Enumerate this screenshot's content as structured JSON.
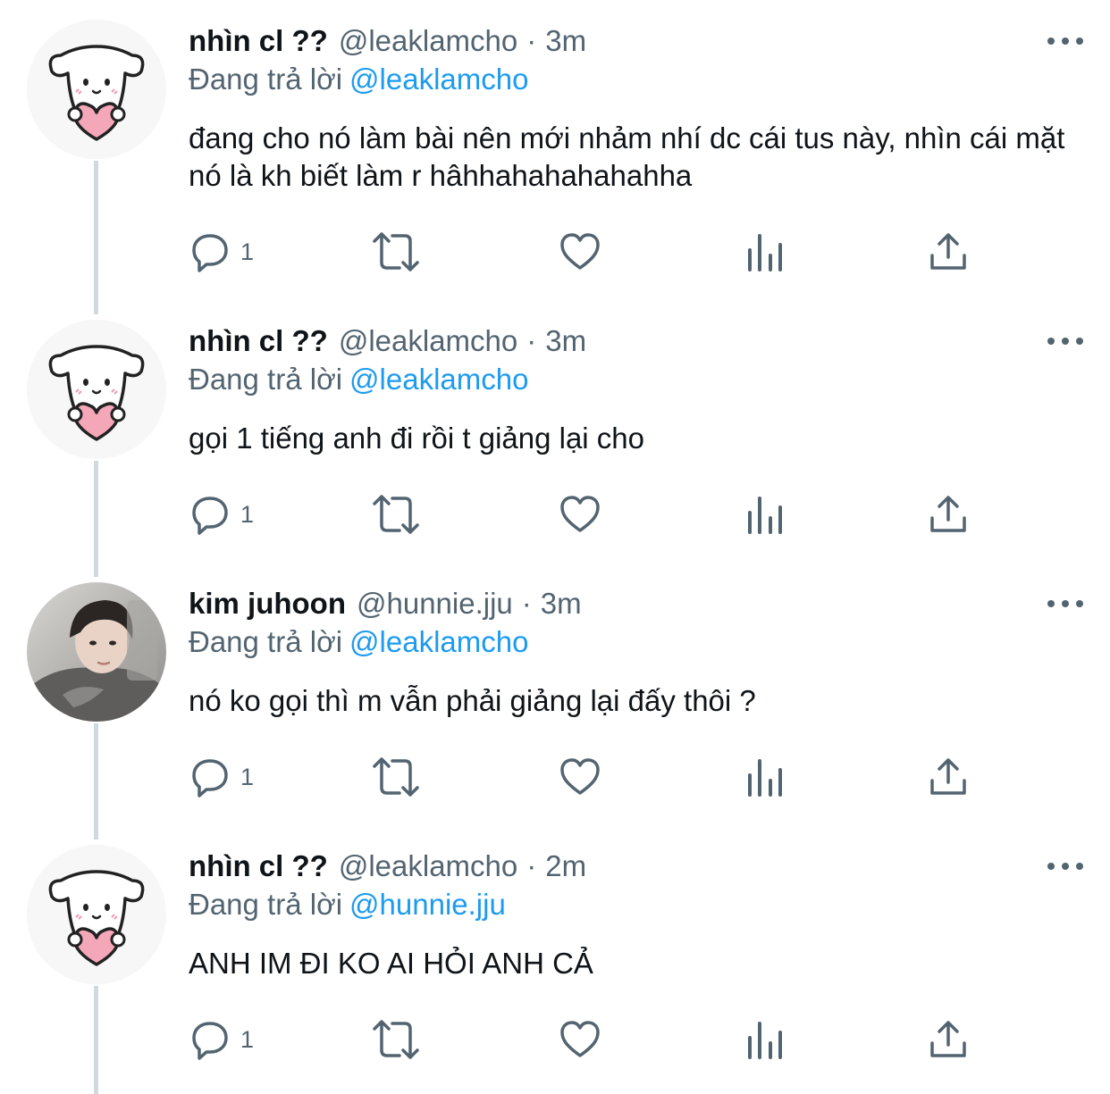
{
  "tweets": [
    {
      "name": "nhìn cl ??",
      "handle": "@leaklamcho",
      "dot": "·",
      "time": "3m",
      "replying_label": "Đang trả lời",
      "replying_to": "@leaklamcho",
      "text": "đang cho nó làm bài nên mới nhảm nhí dc cái tus này, nhìn cái mặt nó là kh biết làm r hâhhahahahahahha",
      "reply_count": "1",
      "avatar": "dog-holding-heart"
    },
    {
      "name": "nhìn cl ??",
      "handle": "@leaklamcho",
      "dot": "·",
      "time": "3m",
      "replying_label": "Đang trả lời",
      "replying_to": "@leaklamcho",
      "text": "gọi 1 tiếng anh đi rồi t giảng lại cho",
      "reply_count": "1",
      "avatar": "dog-holding-heart"
    },
    {
      "name": "kim juhoon",
      "handle": "@hunnie.jju",
      "dot": "·",
      "time": "3m",
      "replying_label": "Đang trả lời",
      "replying_to": "@leaklamcho",
      "text": "nó ko gọi thì m vẫn phải giảng lại đấy thôi ?",
      "reply_count": "1",
      "avatar": "profile-photo"
    },
    {
      "name": "nhìn cl ??",
      "handle": "@leaklamcho",
      "dot": "·",
      "time": "2m",
      "replying_label": "Đang trả lời",
      "replying_to": "@hunnie.jju",
      "text": "ANH IM ĐI KO AI HỎI ANH CẢ",
      "reply_count": "1",
      "avatar": "dog-holding-heart"
    }
  ],
  "icons": {
    "reply": "reply-bubble-icon",
    "retweet": "retweet-icon",
    "like": "heart-icon",
    "views": "views-chart-icon",
    "share": "share-icon",
    "more": "more-dots-icon"
  },
  "colors": {
    "text": "#0f1419",
    "secondary": "#536471",
    "link": "#1d9bf0",
    "thread_line": "#cfd9de",
    "heart_pink": "#f4a7b9"
  }
}
